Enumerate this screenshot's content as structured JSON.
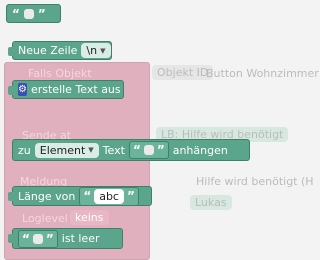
{
  "blocks": {
    "text_empty": {
      "quote_open": "“",
      "quote_close": "”"
    },
    "newline": {
      "label": "Neue Zeile",
      "value": "\\n"
    },
    "create_text": {
      "label": "erstelle Text aus"
    },
    "append": {
      "prefix": "zu",
      "dropdown": "Element",
      "middle": "Text",
      "suffix": "anhängen"
    },
    "length": {
      "label": "Länge von",
      "value": "abc"
    },
    "is_empty": {
      "suffix": "ist leer"
    }
  },
  "background": {
    "falls_objekt": "Falls Objekt",
    "objekt_id": "Objekt ID",
    "button_name": "Button Wohnzimmer",
    "sende_at": "Sende at",
    "meldung": "Meldung",
    "hilfe1": "LB: Hilfe wird benötigt",
    "hilfe2": "Hilfe wird benötigt (H",
    "lukas": "Lukas",
    "loglevel": "Loglevel",
    "keins": "keins"
  },
  "colors": {
    "text_block": "#5ba58c",
    "logic_block": "#d47a93",
    "workspace": "#f3f3f3"
  }
}
